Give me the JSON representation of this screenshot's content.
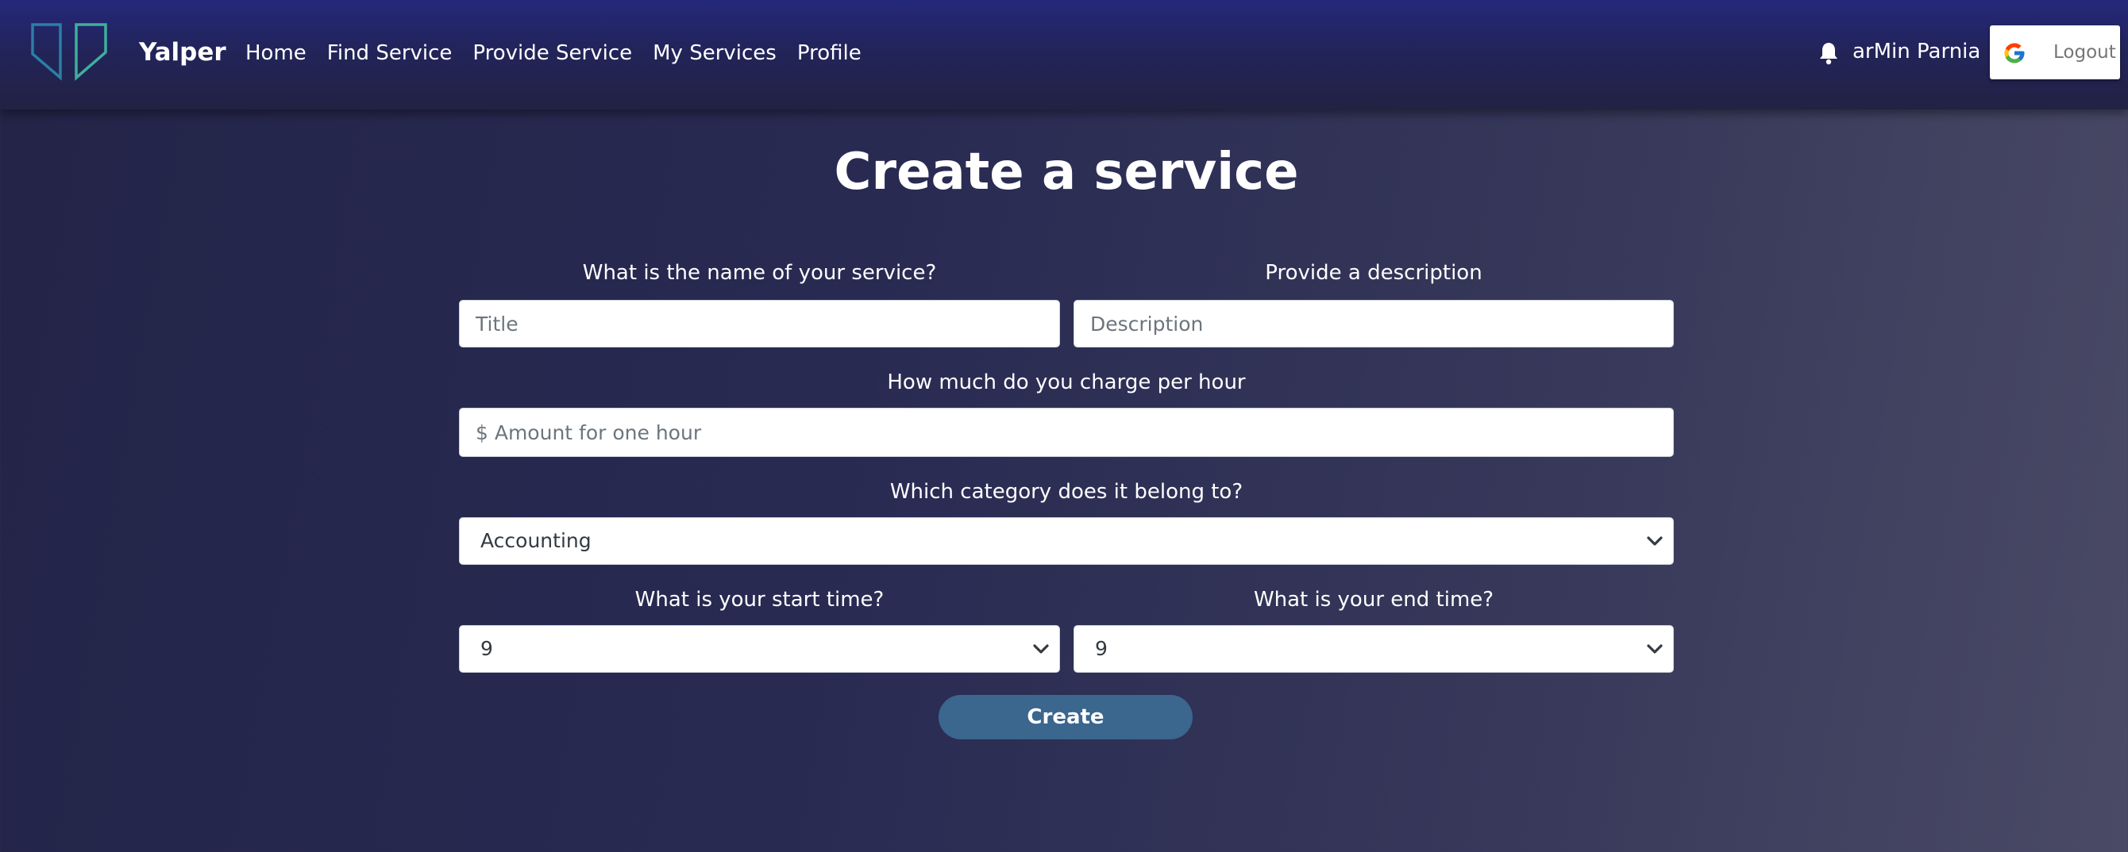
{
  "nav": {
    "brand": "Yalper",
    "links": [
      "Home",
      "Find Service",
      "Provide Service",
      "My Services",
      "Profile"
    ],
    "user_name": "arMin Parnia",
    "logout_label": "Logout"
  },
  "page": {
    "title": "Create a service"
  },
  "form": {
    "name_label": "What is the name of your service?",
    "name_placeholder": "Title",
    "description_label": "Provide a description",
    "description_placeholder": "Description",
    "rate_label": "How much do you charge per hour",
    "rate_placeholder": "$ Amount for one hour",
    "category_label": "Which category does it belong to?",
    "category_value": "Accounting",
    "start_label": "What is your start time?",
    "start_value": "9",
    "end_label": "What is your end time?",
    "end_value": "9",
    "submit_label": "Create"
  },
  "colors": {
    "navbar": "#22245a",
    "button": "#3b668e",
    "logo_teal": "#3fae9d",
    "logo_blue": "#2b7fa6"
  },
  "icons": {
    "logo": "yalper-logo-icon",
    "notification": "bell-icon",
    "google": "google-icon",
    "dropdown": "chevron-down-icon"
  }
}
